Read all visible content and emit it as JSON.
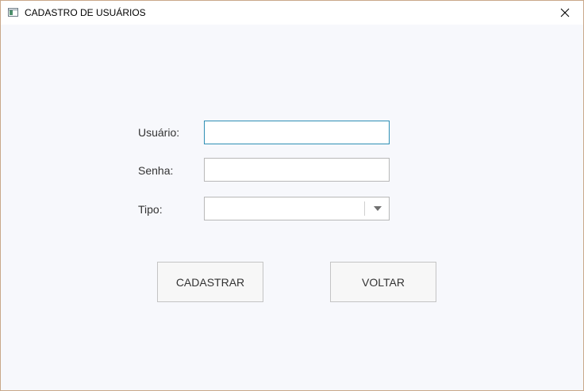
{
  "window": {
    "title": "CADASTRO DE USUÁRIOS"
  },
  "form": {
    "usuario_label": "Usuário:",
    "usuario_value": "",
    "senha_label": "Senha:",
    "senha_value": "",
    "tipo_label": "Tipo:",
    "tipo_selected": ""
  },
  "buttons": {
    "cadastrar_label": "CADASTRAR",
    "voltar_label": "VOLTAR"
  },
  "icons": {
    "app": "window-app-icon",
    "close": "close-icon",
    "dropdown": "chevron-down-icon"
  },
  "colors": {
    "focus_border": "#2e8fb5",
    "window_border": "#c9a88a",
    "background": "#f7f8fc"
  }
}
